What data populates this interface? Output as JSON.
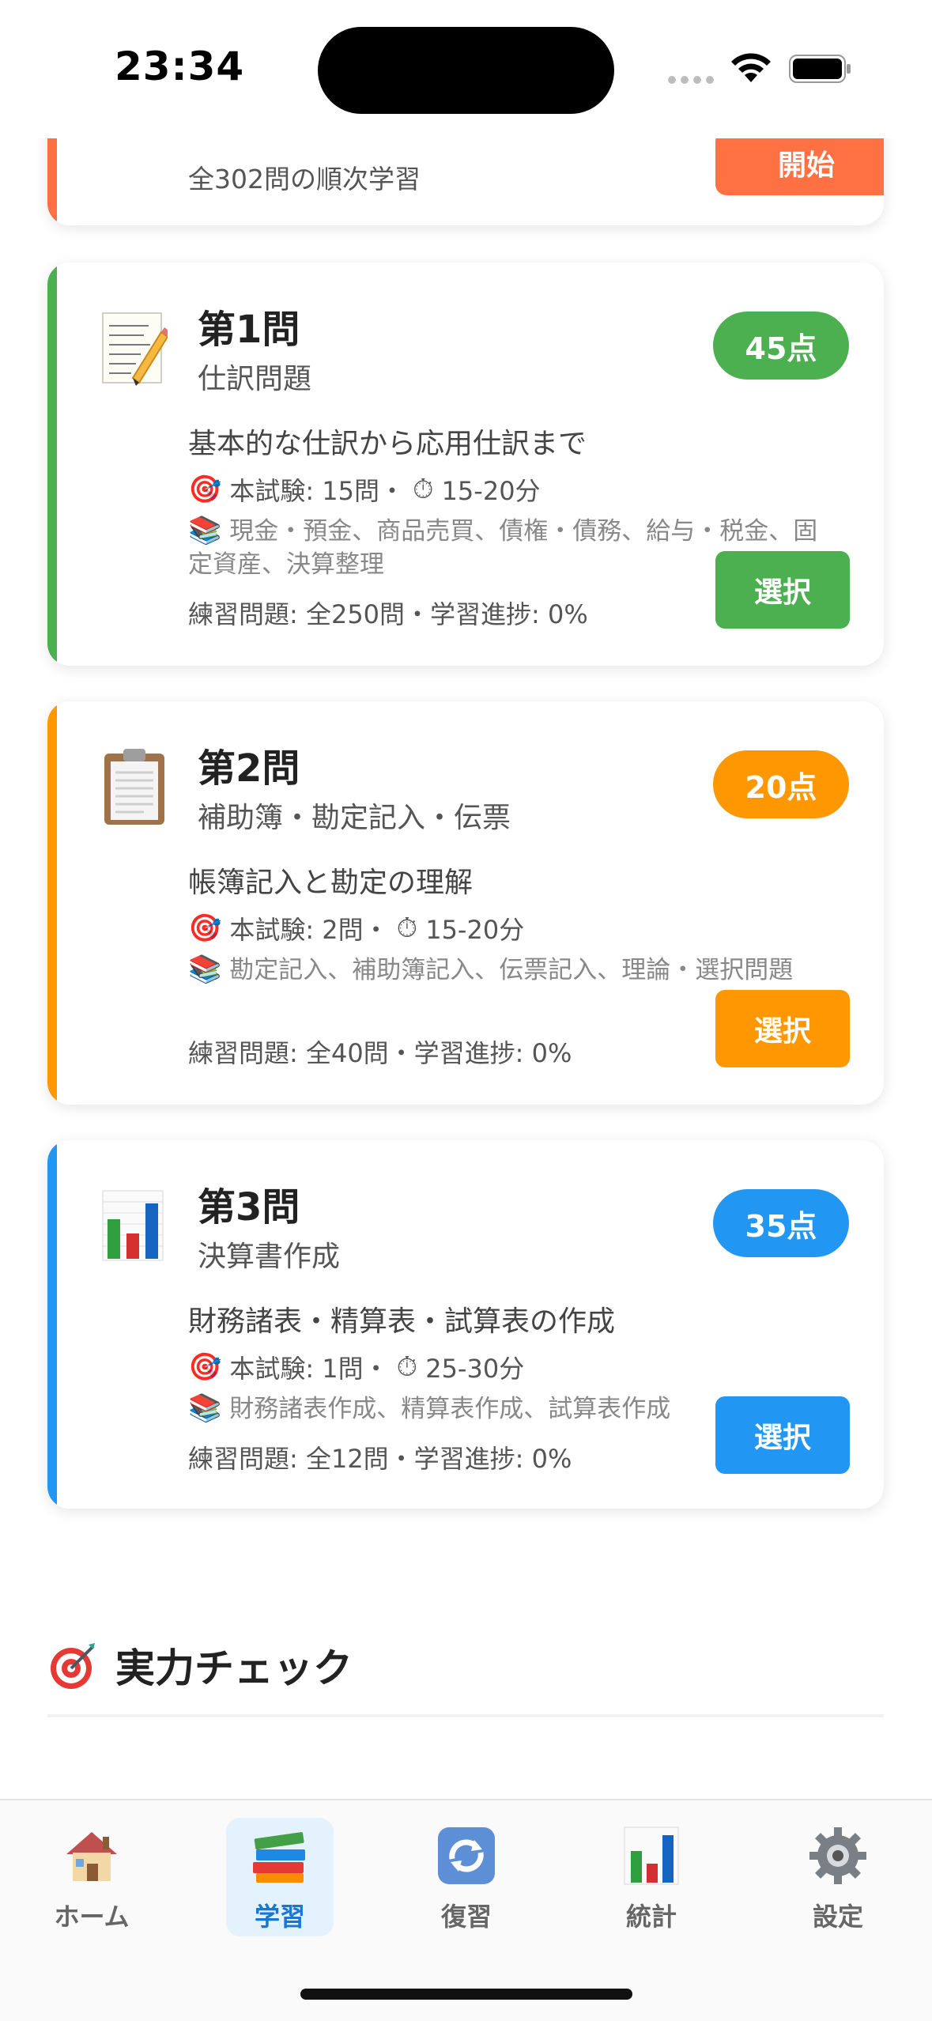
{
  "status_bar": {
    "time": "23:34"
  },
  "top_card": {
    "subtitle": "全302問の順次学習",
    "start_label": "開始",
    "color": "#FF7043"
  },
  "questions": [
    {
      "title": "第1問",
      "subtitle": "仕訳問題",
      "badge": "45点",
      "description": "基本的な仕訳から応用仕訳まで",
      "exam_label": "本試験: 15問・",
      "time_label": "15-20分",
      "topics": "現金・預金、商品売買、債権・債務、給与・税金、固定資産、決算整理",
      "practice": "練習問題: 全250問・学習進捗: 0%",
      "select_label": "選択",
      "color": "#4CAF50",
      "icon": "memo-icon"
    },
    {
      "title": "第2問",
      "subtitle": "補助簿・勘定記入・伝票",
      "badge": "20点",
      "description": "帳簿記入と勘定の理解",
      "exam_label": "本試験: 2問・",
      "time_label": "15-20分",
      "topics": "勘定記入、補助簿記入、伝票記入、理論・選択問題",
      "practice": "練習問題: 全40問・学習進捗: 0%",
      "select_label": "選択",
      "color": "#FF9800",
      "icon": "clipboard-icon"
    },
    {
      "title": "第3問",
      "subtitle": "決算書作成",
      "badge": "35点",
      "description": "財務諸表・精算表・試算表の作成",
      "exam_label": "本試験: 1問・",
      "time_label": "25-30分",
      "topics": "財務諸表作成、精算表作成、試算表作成",
      "practice": "練習問題: 全12問・学習進捗: 0%",
      "select_label": "選択",
      "color": "#2196F3",
      "icon": "bar-chart-icon"
    }
  ],
  "section": {
    "title": "実力チェック",
    "icon": "target-icon"
  },
  "tabs": [
    {
      "label": "ホーム",
      "icon": "house-icon",
      "active": false
    },
    {
      "label": "学習",
      "icon": "books-icon",
      "active": true
    },
    {
      "label": "復習",
      "icon": "repeat-icon",
      "active": false
    },
    {
      "label": "統計",
      "icon": "bar-chart-icon",
      "active": false
    },
    {
      "label": "設定",
      "icon": "gear-icon",
      "active": false
    }
  ]
}
